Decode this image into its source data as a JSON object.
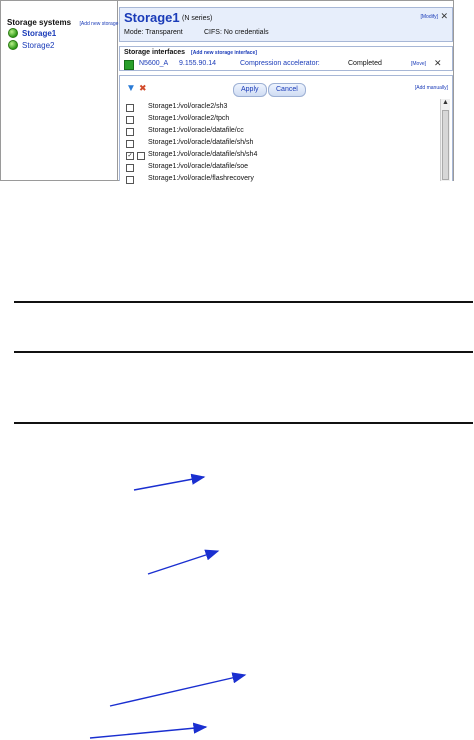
{
  "sidebar": {
    "title": "Storage systems",
    "add_link": "[Add new storage",
    "items": [
      {
        "label": "Storage1"
      },
      {
        "label": "Storage2"
      }
    ]
  },
  "details": {
    "title": "Storage1",
    "series": "(N series)",
    "mode": "Mode: Transparent",
    "cifs": "CIFS: No credentials",
    "modify_link": "[Modify]",
    "close_glyph": "✕"
  },
  "interfaces": {
    "title": "Storage interfaces",
    "add_link": "[Add new storage interface]",
    "row": {
      "name": "N5600_A",
      "ip": "9.155.90.14",
      "compression_label": "Compression accelerator:",
      "status": "Completed",
      "move_link": "[Move]",
      "close_glyph": "✕"
    }
  },
  "toolbar": {
    "apply_label": "Apply",
    "cancel_label": "Cancel",
    "add_manually": "[Add manually]"
  },
  "paths": [
    {
      "text": "Storage1:/vol/oracle2/sh3",
      "checked": false,
      "nested": false
    },
    {
      "text": "Storage1:/vol/oracle2/tpch",
      "checked": false,
      "nested": false
    },
    {
      "text": "Storage1:/vol/oracle/datafile/cc",
      "checked": false,
      "nested": false
    },
    {
      "text": "Storage1:/vol/oracle/datafile/sh/sh",
      "checked": false,
      "nested": false
    },
    {
      "text": "Storage1:/vol/oracle/datafile/sh/sh4",
      "checked": true,
      "nested": true
    },
    {
      "text": "Storage1:/vol/oracle/datafile/soe",
      "checked": false,
      "nested": false
    },
    {
      "text": "Storage1:/vol/oracle/flashrecovery",
      "checked": false,
      "nested": false
    }
  ],
  "colors": {
    "link": "#1a3bb8",
    "header_bg": "#e7eefb",
    "status_green": "#2aa02a",
    "arrow": "#1a2fd0"
  }
}
